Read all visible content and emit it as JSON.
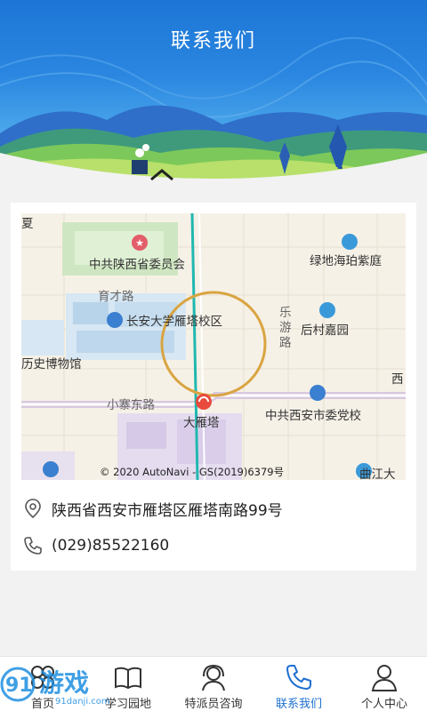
{
  "header": {
    "title": "联系我们"
  },
  "map": {
    "labels": [
      "中共陕西省委员会",
      "绿地海珀紫庭",
      "育才路",
      "长安大学雁塔校区",
      "乐",
      "游",
      "路",
      "后村嘉园",
      "历史博物馆",
      "西",
      "小寨东路",
      "大雁塔",
      "中共西安市委党校",
      "曲江大",
      "夏"
    ],
    "copyright": "© 2020 AutoNavi - GS(2019)6379号"
  },
  "contact": {
    "address": "陕西省西安市雁塔区雁塔南路99号",
    "phone": "(029)85522160"
  },
  "tabs": [
    {
      "label": "首页",
      "icon": "home-icon"
    },
    {
      "label": "学习园地",
      "icon": "book-icon"
    },
    {
      "label": "特派员咨询",
      "icon": "headset-icon"
    },
    {
      "label": "联系我们",
      "icon": "phone-icon"
    },
    {
      "label": "个人中心",
      "icon": "user-icon"
    }
  ],
  "colors": {
    "accent": "#1e6fd0",
    "header": "#2a86e0",
    "ring": "#d9a441"
  },
  "watermark": {
    "main": "游戏",
    "sub": "91danji.com",
    "digits": "91"
  }
}
